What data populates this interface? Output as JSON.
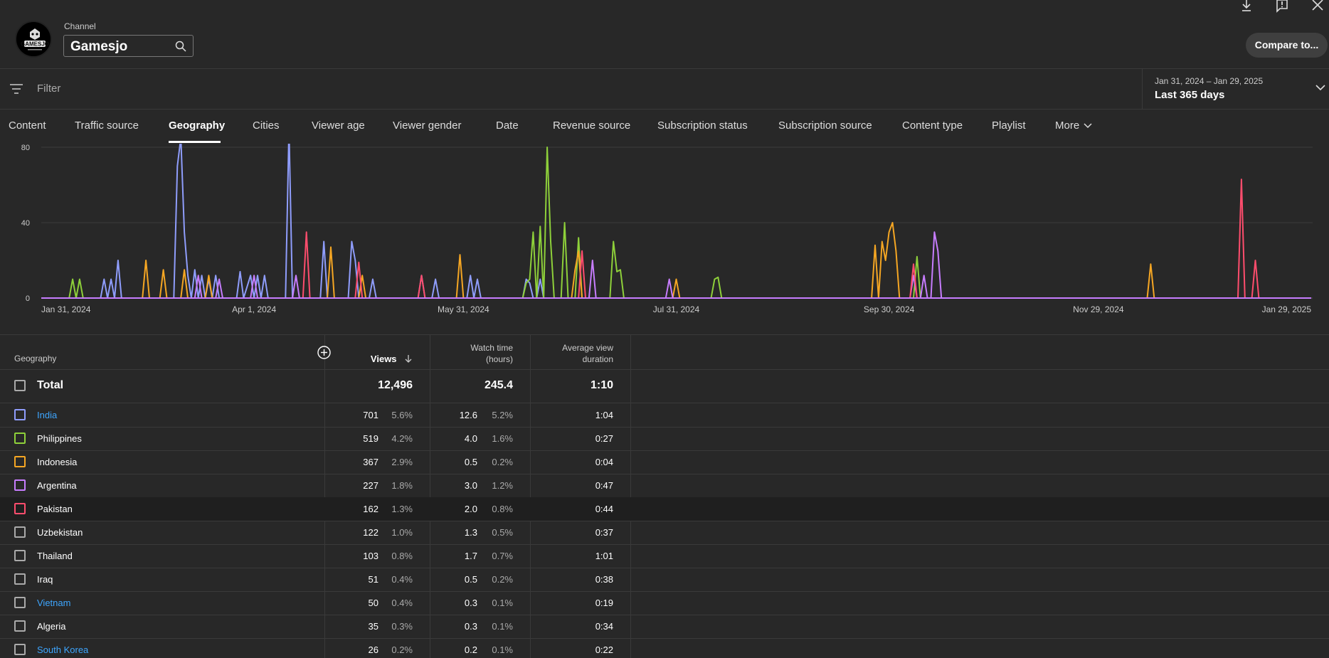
{
  "header": {
    "channel_label": "Channel",
    "channel_name": "Gamesjo",
    "compare_label": "Compare to...",
    "avatar_text": "GAMESJO"
  },
  "filter": {
    "placeholder": "Filter"
  },
  "date_range": {
    "range": "Jan 31, 2024 – Jan 29, 2025",
    "label": "Last 365 days"
  },
  "tabs": [
    {
      "label": "Content"
    },
    {
      "label": "Traffic source"
    },
    {
      "label": "Geography",
      "active": true
    },
    {
      "label": "Cities"
    },
    {
      "label": "Viewer age"
    },
    {
      "label": "Viewer gender"
    },
    {
      "label": "Date"
    },
    {
      "label": "Revenue source"
    },
    {
      "label": "Subscription status"
    },
    {
      "label": "Subscription source"
    },
    {
      "label": "Content type"
    },
    {
      "label": "Playlist"
    },
    {
      "label": "More"
    }
  ],
  "colors": {
    "India": "#8f9dfc",
    "Philippines": "#8ed03a",
    "Indonesia": "#f5a623",
    "Argentina": "#c77dff",
    "Pakistan": "#ff4d6d",
    "accent_link": "#3ea6ff"
  },
  "chart_data": {
    "type": "line",
    "x_start": "2024-01-31",
    "x_end": "2025-01-29",
    "x_tick_labels": [
      "Jan 31, 2024",
      "Apr 1, 2024",
      "May 31, 2024",
      "Jul 31, 2024",
      "Sep 30, 2024",
      "Nov 29, 2024",
      "Jan 29, 2025"
    ],
    "y_tick_labels": [
      "0",
      "40",
      "80"
    ],
    "ylim": [
      0,
      80
    ],
    "grid": true,
    "series": [
      {
        "name": "India",
        "points": [
          [
            17,
            0
          ],
          [
            18,
            10
          ],
          [
            19,
            0
          ],
          [
            20,
            10
          ],
          [
            21,
            0
          ],
          [
            22,
            20
          ],
          [
            23,
            0
          ],
          [
            38,
            0
          ],
          [
            39,
            70
          ],
          [
            40,
            85
          ],
          [
            41,
            35
          ],
          [
            42,
            12
          ],
          [
            43,
            0
          ],
          [
            44,
            15
          ],
          [
            45,
            0
          ],
          [
            46,
            12
          ],
          [
            47,
            0
          ],
          [
            48,
            10
          ],
          [
            49,
            0
          ],
          [
            50,
            12
          ],
          [
            51,
            0
          ],
          [
            56,
            0
          ],
          [
            57,
            14
          ],
          [
            58,
            0
          ],
          [
            60,
            12
          ],
          [
            61,
            0
          ],
          [
            62,
            12
          ],
          [
            63,
            0
          ],
          [
            64,
            12
          ],
          [
            65,
            0
          ],
          [
            70,
            0
          ],
          [
            71,
            90
          ],
          [
            72,
            0
          ],
          [
            80,
            0
          ],
          [
            81,
            30
          ],
          [
            82,
            0
          ],
          [
            88,
            0
          ],
          [
            89,
            30
          ],
          [
            90,
            20
          ],
          [
            91,
            0
          ],
          [
            94,
            0
          ],
          [
            95,
            10
          ],
          [
            96,
            0
          ],
          [
            108,
            0
          ],
          [
            109,
            12
          ],
          [
            110,
            0
          ],
          [
            112,
            0
          ],
          [
            113,
            10
          ],
          [
            114,
            0
          ],
          [
            122,
            0
          ],
          [
            123,
            12
          ],
          [
            124,
            0
          ],
          [
            125,
            10
          ],
          [
            126,
            0
          ],
          [
            138,
            0
          ],
          [
            139,
            10
          ],
          [
            140,
            8
          ],
          [
            141,
            0
          ],
          [
            142,
            0
          ],
          [
            143,
            10
          ],
          [
            144,
            0
          ]
        ]
      },
      {
        "name": "Philippines",
        "points": [
          [
            8,
            0
          ],
          [
            9,
            10
          ],
          [
            10,
            0
          ],
          [
            11,
            10
          ],
          [
            12,
            0
          ],
          [
            138,
            0
          ],
          [
            139,
            8
          ],
          [
            140,
            10
          ],
          [
            141,
            35
          ],
          [
            142,
            0
          ],
          [
            143,
            38
          ],
          [
            144,
            0
          ],
          [
            145,
            80
          ],
          [
            146,
            30
          ],
          [
            147,
            0
          ],
          [
            149,
            0
          ],
          [
            150,
            40
          ],
          [
            151,
            0
          ],
          [
            153,
            0
          ],
          [
            154,
            32
          ],
          [
            155,
            0
          ],
          [
            163,
            0
          ],
          [
            164,
            30
          ],
          [
            165,
            14
          ],
          [
            166,
            15
          ],
          [
            167,
            0
          ],
          [
            192,
            0
          ],
          [
            193,
            10
          ],
          [
            194,
            11
          ],
          [
            195,
            0
          ],
          [
            250,
            0
          ],
          [
            251,
            22
          ],
          [
            252,
            0
          ]
        ]
      },
      {
        "name": "Indonesia",
        "points": [
          [
            29,
            0
          ],
          [
            30,
            20
          ],
          [
            31,
            0
          ],
          [
            34,
            0
          ],
          [
            35,
            15
          ],
          [
            36,
            0
          ],
          [
            40,
            0
          ],
          [
            41,
            15
          ],
          [
            42,
            0
          ],
          [
            47,
            0
          ],
          [
            48,
            12
          ],
          [
            49,
            0
          ],
          [
            82,
            0
          ],
          [
            83,
            27
          ],
          [
            84,
            0
          ],
          [
            91,
            0
          ],
          [
            92,
            12
          ],
          [
            93,
            0
          ],
          [
            119,
            0
          ],
          [
            120,
            23
          ],
          [
            121,
            0
          ],
          [
            152,
            0
          ],
          [
            153,
            15
          ],
          [
            154,
            25
          ],
          [
            155,
            0
          ],
          [
            181,
            0
          ],
          [
            182,
            10
          ],
          [
            183,
            0
          ],
          [
            238,
            0
          ],
          [
            239,
            28
          ],
          [
            240,
            0
          ],
          [
            241,
            30
          ],
          [
            242,
            20
          ],
          [
            243,
            35
          ],
          [
            244,
            40
          ],
          [
            245,
            25
          ],
          [
            246,
            0
          ],
          [
            317,
            0
          ],
          [
            318,
            18
          ],
          [
            319,
            0
          ]
        ]
      },
      {
        "name": "Argentina",
        "points": [
          [
            44,
            0
          ],
          [
            45,
            12
          ],
          [
            46,
            0
          ],
          [
            50,
            0
          ],
          [
            51,
            10
          ],
          [
            52,
            0
          ],
          [
            60,
            0
          ],
          [
            61,
            12
          ],
          [
            62,
            0
          ],
          [
            72,
            0
          ],
          [
            73,
            12
          ],
          [
            74,
            0
          ],
          [
            157,
            0
          ],
          [
            158,
            20
          ],
          [
            159,
            0
          ],
          [
            179,
            0
          ],
          [
            180,
            10
          ],
          [
            181,
            0
          ],
          [
            249,
            0
          ],
          [
            250,
            12
          ],
          [
            251,
            0
          ],
          [
            252,
            0
          ],
          [
            253,
            12
          ],
          [
            254,
            0
          ],
          [
            255,
            0
          ],
          [
            256,
            35
          ],
          [
            257,
            25
          ],
          [
            258,
            0
          ]
        ]
      },
      {
        "name": "Pakistan",
        "points": [
          [
            75,
            0
          ],
          [
            76,
            35
          ],
          [
            77,
            0
          ],
          [
            90,
            0
          ],
          [
            91,
            19
          ],
          [
            92,
            0
          ],
          [
            108,
            0
          ],
          [
            109,
            12
          ],
          [
            110,
            0
          ],
          [
            154,
            0
          ],
          [
            155,
            25
          ],
          [
            156,
            0
          ],
          [
            249,
            0
          ],
          [
            250,
            18
          ],
          [
            251,
            0
          ],
          [
            343,
            0
          ],
          [
            344,
            63
          ],
          [
            345,
            0
          ],
          [
            347,
            0
          ],
          [
            348,
            20
          ],
          [
            349,
            0
          ]
        ]
      }
    ]
  },
  "table": {
    "headers": {
      "dimension": "Geography",
      "views": "Views",
      "watch_time_line1": "Watch time",
      "watch_time_line2": "(hours)",
      "avd_line1": "Average view",
      "avd_line2": "duration"
    },
    "total": {
      "label": "Total",
      "views": "12,496",
      "watch_time": "245.4",
      "avd": "1:10"
    },
    "rows": [
      {
        "name": "India",
        "views": "701",
        "views_pct": "5.6%",
        "watch": "12.6",
        "watch_pct": "5.2%",
        "avd": "1:04",
        "link": true,
        "color": "#8f9dfc"
      },
      {
        "name": "Philippines",
        "views": "519",
        "views_pct": "4.2%",
        "watch": "4.0",
        "watch_pct": "1.6%",
        "avd": "0:27",
        "link": false,
        "color": "#8ed03a"
      },
      {
        "name": "Indonesia",
        "views": "367",
        "views_pct": "2.9%",
        "watch": "0.5",
        "watch_pct": "0.2%",
        "avd": "0:04",
        "link": false,
        "color": "#f5a623"
      },
      {
        "name": "Argentina",
        "views": "227",
        "views_pct": "1.8%",
        "watch": "3.0",
        "watch_pct": "1.2%",
        "avd": "0:47",
        "link": false,
        "color": "#c77dff"
      },
      {
        "name": "Pakistan",
        "views": "162",
        "views_pct": "1.3%",
        "watch": "2.0",
        "watch_pct": "0.8%",
        "avd": "0:44",
        "link": false,
        "color": "#ff4d6d",
        "highlight": true
      },
      {
        "name": "Uzbekistan",
        "views": "122",
        "views_pct": "1.0%",
        "watch": "1.3",
        "watch_pct": "0.5%",
        "avd": "0:37",
        "link": false
      },
      {
        "name": "Thailand",
        "views": "103",
        "views_pct": "0.8%",
        "watch": "1.7",
        "watch_pct": "0.7%",
        "avd": "1:01",
        "link": false
      },
      {
        "name": "Iraq",
        "views": "51",
        "views_pct": "0.4%",
        "watch": "0.5",
        "watch_pct": "0.2%",
        "avd": "0:38",
        "link": false
      },
      {
        "name": "Vietnam",
        "views": "50",
        "views_pct": "0.4%",
        "watch": "0.3",
        "watch_pct": "0.1%",
        "avd": "0:19",
        "link": true
      },
      {
        "name": "Algeria",
        "views": "35",
        "views_pct": "0.3%",
        "watch": "0.3",
        "watch_pct": "0.1%",
        "avd": "0:34",
        "link": false
      },
      {
        "name": "South Korea",
        "views": "26",
        "views_pct": "0.2%",
        "watch": "0.2",
        "watch_pct": "0.1%",
        "avd": "0:22",
        "link": true
      }
    ]
  }
}
